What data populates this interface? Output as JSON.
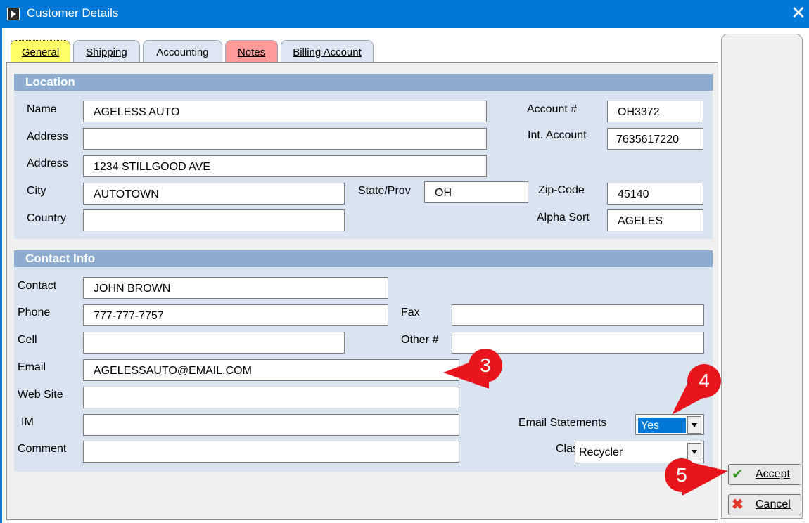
{
  "window": {
    "title": "Customer Details",
    "close_glyph": "✕"
  },
  "tabs": [
    {
      "label": "General"
    },
    {
      "label": "Shipping"
    },
    {
      "label": "Accounting"
    },
    {
      "label": "Notes"
    },
    {
      "label": "Billing Account"
    }
  ],
  "location": {
    "header": "Location",
    "name_label": "Name",
    "name_value": "AGELESS AUTO",
    "address1_label": "Address",
    "address1_value": "",
    "address2_label": "Address",
    "address2_value": "1234 STILLGOOD AVE",
    "city_label": "City",
    "city_value": "AUTOTOWN",
    "state_label": "State/Prov",
    "state_value": "OH",
    "country_label": "Country",
    "country_value": "",
    "account_label": "Account #",
    "account_value": "OH3372",
    "int_account_label": "Int. Account",
    "int_account_value": "7635617220",
    "zip_label": "Zip-Code",
    "zip_value": "45140",
    "alpha_label": "Alpha Sort",
    "alpha_value": "AGELES"
  },
  "contact": {
    "header": "Contact Info",
    "contact_label": "Contact",
    "contact_value": "JOHN BROWN",
    "phone_label": "Phone",
    "phone_value": "777-777-7757",
    "cell_label": "Cell",
    "cell_value": "",
    "email_label": "Email",
    "email_value": "AGELESSAUTO@EMAIL.COM",
    "website_label": "Web Site",
    "website_value": "",
    "im_label": "IM",
    "im_value": "",
    "comment_label": "Comment",
    "comment_value": "",
    "fax_label": "Fax",
    "fax_value": "",
    "other_label": "Other #",
    "other_value": "",
    "email_statements_label": "Email Statements",
    "email_statements_value": "Yes",
    "class_label": "Class",
    "class_value": "Recycler"
  },
  "buttons": {
    "accept": "Accept",
    "cancel": "Cancel"
  },
  "callouts": [
    "3",
    "4",
    "5"
  ],
  "colors": {
    "callout": "#e8151c",
    "titlebar": "#0078d7",
    "section_header": "#8eacd0",
    "section_bg": "#d8e4f0"
  },
  "icons": {
    "accept": "checkmark-icon",
    "cancel": "x-icon",
    "app": "app-icon"
  }
}
